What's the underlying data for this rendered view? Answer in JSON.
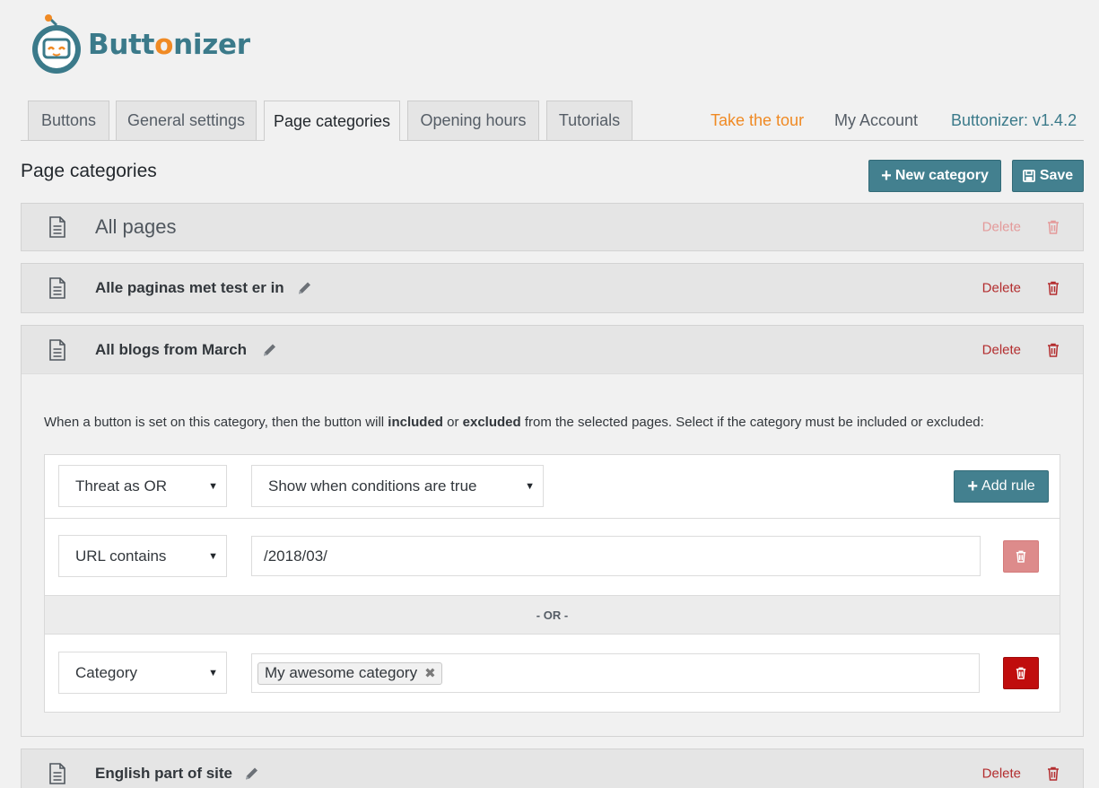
{
  "brand": {
    "name_pre": "Butt",
    "name_o": "o",
    "name_post": "nizer"
  },
  "tabs": [
    {
      "label": "Buttons"
    },
    {
      "label": "General settings"
    },
    {
      "label": "Page categories"
    },
    {
      "label": "Opening hours"
    },
    {
      "label": "Tutorials"
    }
  ],
  "active_tab": "Page categories",
  "top_links": {
    "tour": "Take the tour",
    "account": "My Account",
    "version": "Buttonizer: v1.4.2"
  },
  "page_title": "Page categories",
  "actions": {
    "new_category": "New category",
    "save": "Save"
  },
  "categories": [
    {
      "title": "All pages",
      "delete_label": "Delete"
    },
    {
      "title": "Alle paginas met test er in",
      "delete_label": "Delete"
    },
    {
      "title": "All blogs from March",
      "delete_label": "Delete"
    },
    {
      "title": "English part of site",
      "delete_label": "Delete"
    }
  ],
  "expanded": {
    "desc_1": "When a button is set on this category, then the button will ",
    "desc_b1": "included",
    "desc_2": " or ",
    "desc_b2": "excluded",
    "desc_3": " from the selected pages. Select if the category must be included or excluded:",
    "logic_select": "Threat as OR",
    "visibility_select": "Show when conditions are true",
    "add_rule": "Add rule",
    "rules": [
      {
        "type": "URL contains",
        "value": "/2018/03/"
      },
      {
        "type": "Category",
        "tag": "My awesome category"
      }
    ],
    "or_separator": "- OR -"
  },
  "colors": {
    "brand_teal": "#3b7a8a",
    "accent_orange": "#f08a24",
    "button_teal": "#43808f",
    "danger_red": "#c00d0d"
  },
  "icons": [
    "logo-robot-icon",
    "plus-icon",
    "save-icon",
    "document-icon",
    "pencil-icon",
    "trash-icon",
    "caret-down-icon",
    "remove-tag-icon"
  ]
}
